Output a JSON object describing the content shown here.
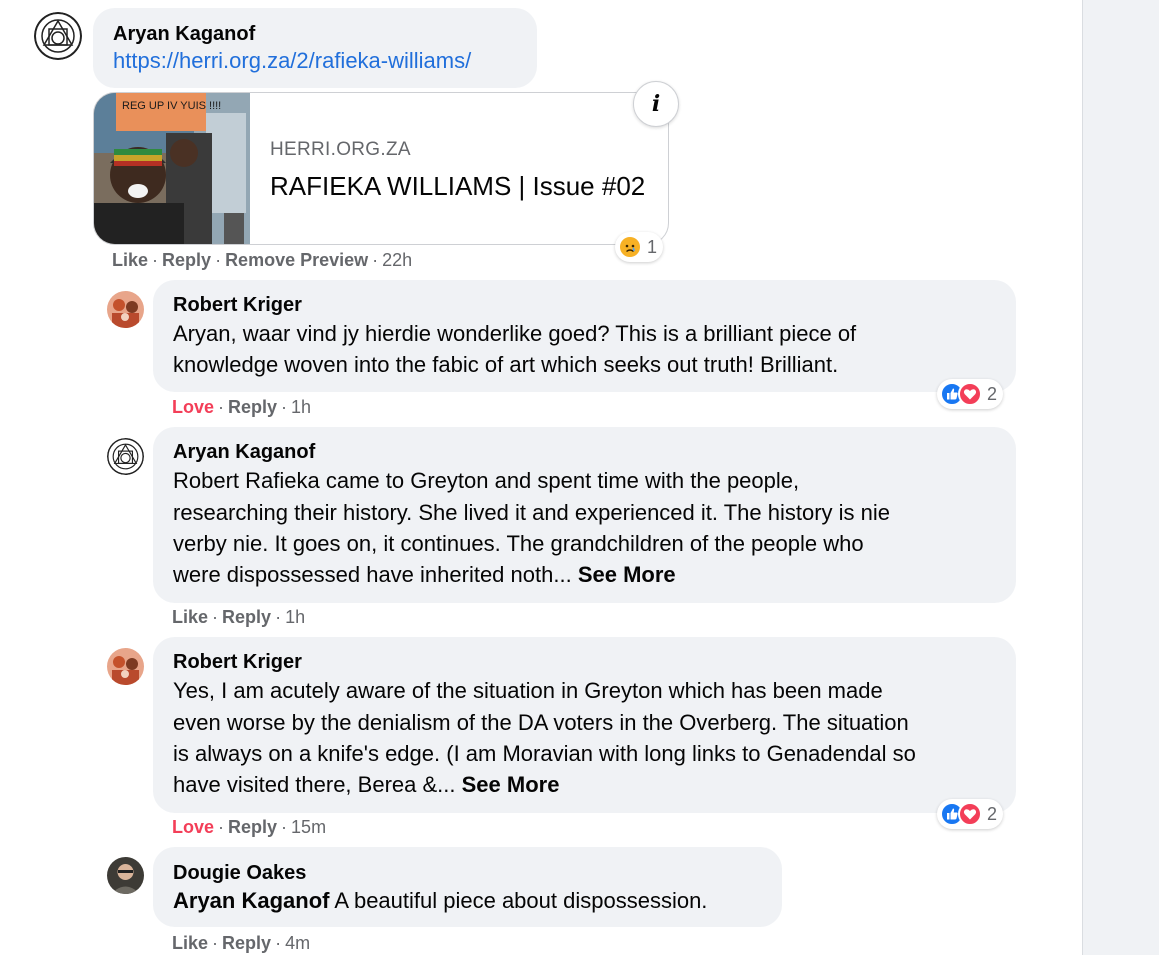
{
  "thread": {
    "main": {
      "author": "Aryan Kaganof",
      "link": "https://herri.org.za/2/rafieka-williams/",
      "preview": {
        "domain": "HERRI.ORG.ZA",
        "title": "RAFIEKA WILLIAMS | Issue #02",
        "thumb_sign_text": "REG UP IV YUIS !!!!"
      },
      "reaction_count": "1",
      "actions": {
        "like": "Like",
        "reply": "Reply",
        "remove_preview": "Remove Preview",
        "time": "22h"
      }
    },
    "replies": [
      {
        "author": "Robert Kriger",
        "lines": [
          "Aryan, waar vind jy hierdie wonderlike goed? This is a brilliant piece of",
          "knowledge woven into the fabic of art which seeks out truth! Brilliant."
        ],
        "reaction_count": "2",
        "actions": {
          "like": "Love",
          "reply": "Reply",
          "time": "1h"
        }
      },
      {
        "author": "Aryan Kaganof",
        "lines": [
          "Robert Rafieka came to Greyton and spent time with the people,",
          "researching their history. She lived it and experienced it. The history is nie",
          "verby nie. It goes on, it continues. The grandchildren of the people who",
          "were dispossessed have inherited noth..."
        ],
        "see_more": "See More",
        "actions": {
          "like": "Like",
          "reply": "Reply",
          "time": "1h"
        }
      },
      {
        "author": "Robert Kriger",
        "lines": [
          "Yes, I am acutely aware of the situation in Greyton which has been made",
          "even worse by the denialism of the DA voters in the Overberg. The situation",
          "is always on a knife's edge. (I am Moravian with long links to Genadendal so",
          "have visited there, Berea &..."
        ],
        "see_more": "See More",
        "reaction_count": "2",
        "actions": {
          "like": "Love",
          "reply": "Reply",
          "time": "15m"
        }
      },
      {
        "author": "Dougie Oakes",
        "mention": "Aryan Kaganof",
        "text": " A beautiful piece about dispossession.",
        "actions": {
          "like": "Like",
          "reply": "Reply",
          "time": "4m"
        }
      }
    ]
  },
  "colors": {
    "bubble": "#f0f2f5",
    "link": "#216fdb",
    "love": "#f33e58",
    "meta": "#65676b"
  },
  "icons": {
    "info": "i",
    "sad": "sad-reaction-icon",
    "like": "like-reaction-icon",
    "love": "love-reaction-icon"
  }
}
